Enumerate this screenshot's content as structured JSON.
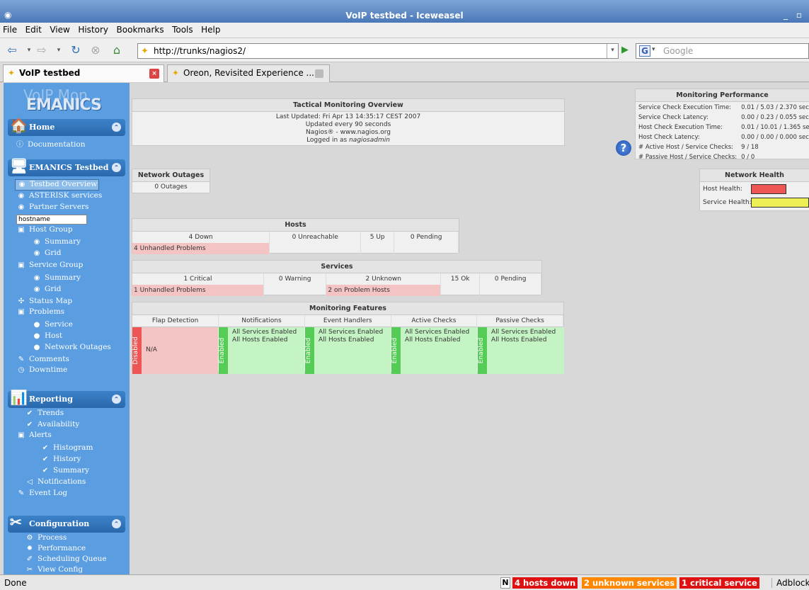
{
  "window": {
    "title": "VoIP testbed - Iceweasel"
  },
  "menu": [
    "File",
    "Edit",
    "View",
    "History",
    "Bookmarks",
    "Tools",
    "Help"
  ],
  "url": "http://trunks/nagios2/",
  "search_placeholder": "Google",
  "tabs": [
    {
      "label": "VoIP testbed"
    },
    {
      "label": "Oreon, Revisited Experience ..."
    }
  ],
  "logo": {
    "ghost": "VoIP Mon",
    "main": "EMANICS"
  },
  "sidebar": {
    "home": {
      "title": "Home",
      "items": [
        "Documentation"
      ]
    },
    "testbed": {
      "title": "EMANICS Testbed",
      "items": [
        "Testbed Overview",
        "ASTERISK services",
        "Partner Servers"
      ],
      "search_value": "hostname",
      "host_group": "Host Group",
      "host_group_items": [
        "Summary",
        "Grid"
      ],
      "service_group": "Service Group",
      "service_group_items": [
        "Summary",
        "Grid"
      ],
      "status_map": "Status Map",
      "problems": "Problems",
      "problems_items": [
        "Service",
        "Host",
        "Network Outages"
      ],
      "comments": "Comments",
      "downtime": "Downtime"
    },
    "reporting": {
      "title": "Reporting",
      "trends": "Trends",
      "availability": "Availability",
      "alerts": "Alerts",
      "alerts_items": [
        "Histogram",
        "History",
        "Summary"
      ],
      "notifications": "Notifications",
      "event_log": "Event Log"
    },
    "configuration": {
      "title": "Configuration",
      "items": [
        "Process",
        "Performance",
        "Scheduling Queue",
        "View Config"
      ]
    }
  },
  "tactical": {
    "title": "Tactical Monitoring Overview",
    "last_updated": "Last Updated: Fri Apr 13 14:35:17 CEST 2007",
    "update_interval": "Updated every 90 seconds",
    "nagios": "Nagios® - www.nagios.org",
    "logged_in_prefix": "Logged in as ",
    "user": "nagiosadmin"
  },
  "outages": {
    "title": "Network Outages",
    "value": "0 Outages"
  },
  "hosts": {
    "title": "Hosts",
    "down": "4 Down",
    "unreachable": "0 Unreachable",
    "up": "5 Up",
    "pending": "0 Pending",
    "unhandled": "4 Unhandled Problems"
  },
  "services": {
    "title": "Services",
    "critical": "1 Critical",
    "warning": "0 Warning",
    "unknown": "2 Unknown",
    "ok": "15 Ok",
    "pending": "0 Pending",
    "unhandled": "1 Unhandled Problems",
    "on_problem_hosts": "2 on Problem Hosts"
  },
  "features": {
    "title": "Monitoring Features",
    "headers": [
      "Flap Detection",
      "Notifications",
      "Event Handlers",
      "Active Checks",
      "Passive Checks"
    ],
    "flap": {
      "state": "Disabled",
      "text": "N/A"
    },
    "enabled_label": "Enabled",
    "services_enabled": "All Services Enabled",
    "hosts_enabled": "All Hosts Enabled"
  },
  "performance": {
    "title": "Monitoring Performance",
    "rows": [
      {
        "label": "Service Check Execution Time:",
        "value": "0.01 / 5.03 / 2.370 sec"
      },
      {
        "label": "Service Check Latency:",
        "value": "0.00 / 0.23 / 0.055 sec"
      },
      {
        "label": "Host Check Execution Time:",
        "value": "0.01 / 10.01 / 1.365 sec"
      },
      {
        "label": "Host Check Latency:",
        "value": "0.00 / 0.00 / 0.000 sec"
      },
      {
        "label": "# Active Host / Service Checks:",
        "value": "9 / 18"
      },
      {
        "label": "# Passive Host / Service Checks:",
        "value": "0 / 0"
      }
    ]
  },
  "health": {
    "title": "Network Health",
    "host_label": "Host Health:",
    "service_label": "Service Health:",
    "host_color": "#ee5555",
    "service_color": "#eeee55"
  },
  "status": {
    "done": "Done",
    "n": "N",
    "hosts_down": "4 hosts down",
    "unknown_services": "2 unknown services",
    "critical_service": "1 critical service",
    "adblock": "Adblock"
  },
  "colors": {
    "red_badge": "#dd1111",
    "orange_badge": "#ff8800",
    "enabled_green": "#c4f4c4",
    "disabled_red": "#f4c4c4"
  }
}
